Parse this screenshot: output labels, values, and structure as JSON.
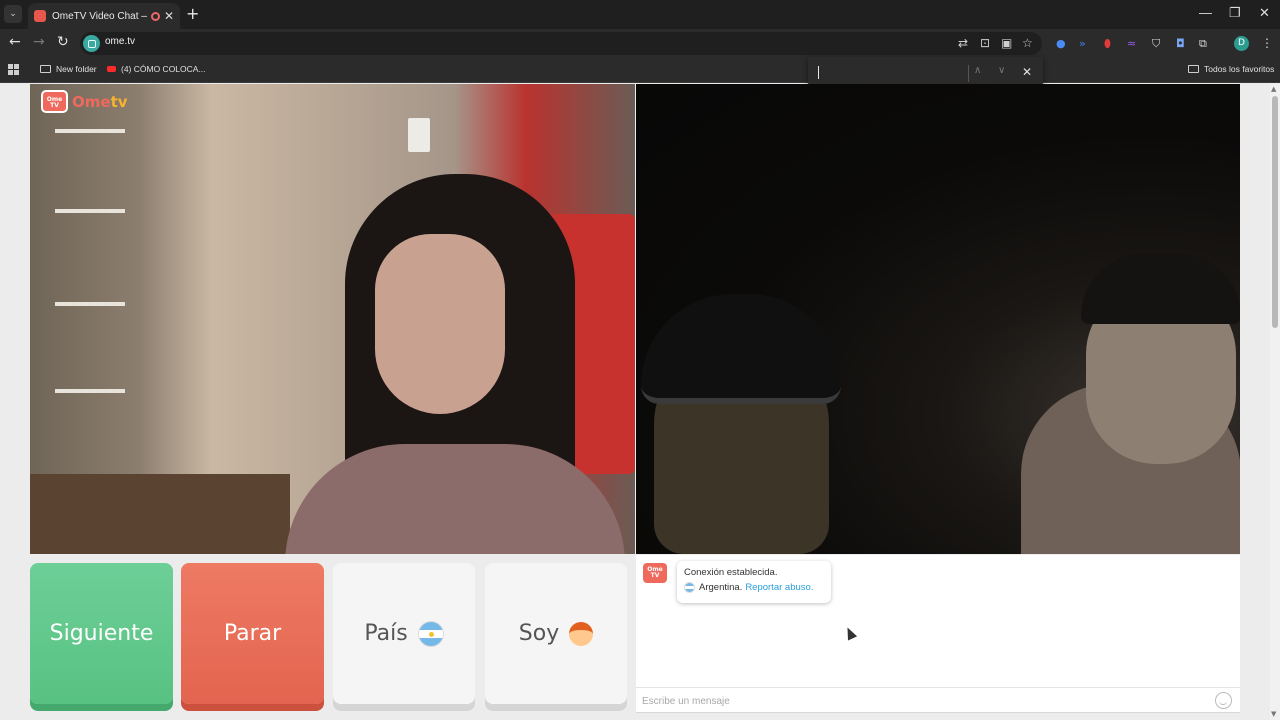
{
  "browser": {
    "tab_title": "OmeTV Video Chat — Ome",
    "url": "ome.tv",
    "bookmarks": [
      "New folder",
      "(4) CÓMO COLOCA..."
    ],
    "all_bookmarks": "Todos los favoritos",
    "profile_initial": "D"
  },
  "video": {
    "logo_text_ome": "Ome",
    "logo_text_tv": "tv",
    "logo_badge": "Ome TV"
  },
  "controls": {
    "next_label": "Siguiente",
    "stop_label": "Parar",
    "country_label": "País",
    "gender_label": "Soy",
    "colors": {
      "next": "#5cc688",
      "stop": "#e86b55",
      "neutral": "#f5f5f5"
    }
  },
  "chat": {
    "status_message": "Conexión establecida.",
    "country": "Argentina.",
    "report_link": "Reportar abuso.",
    "input_placeholder": "Escribe un mensaje"
  }
}
